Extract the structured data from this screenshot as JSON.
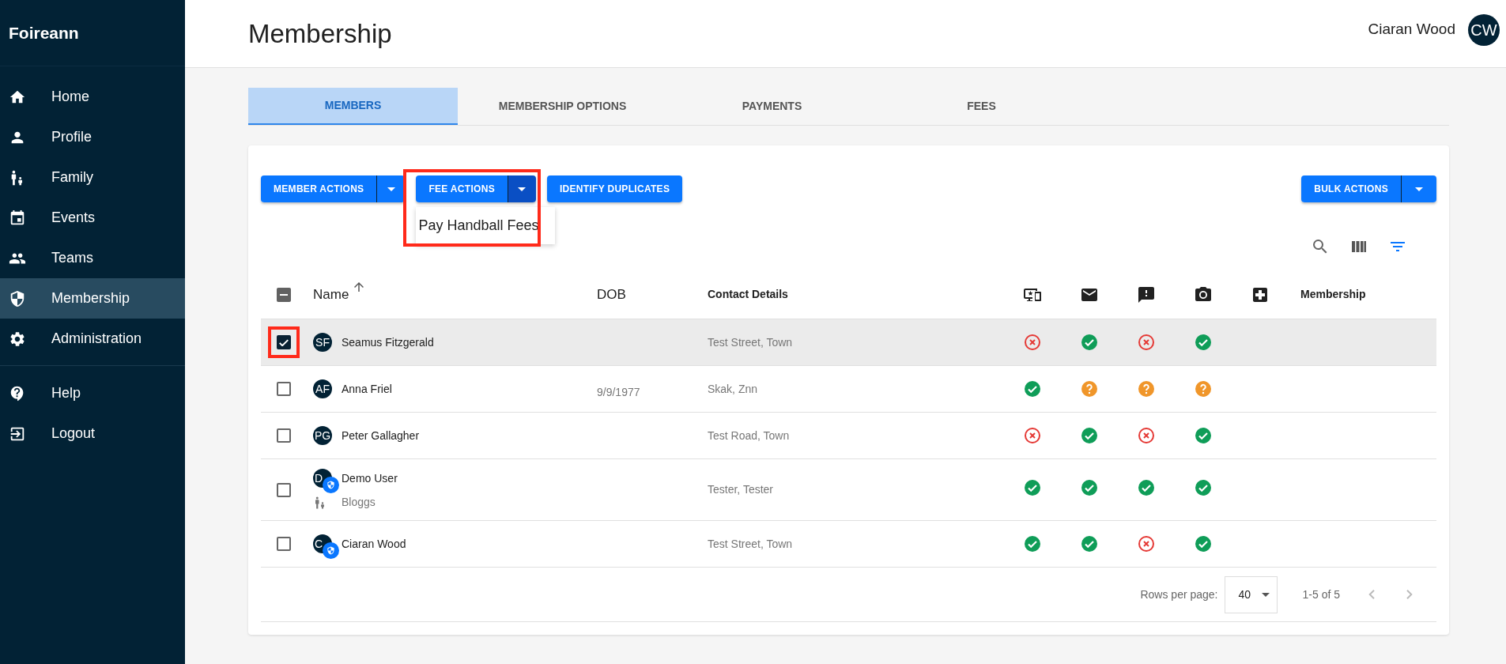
{
  "sidebar": {
    "brand": "Foireann",
    "items": [
      {
        "label": "Home",
        "selected": false
      },
      {
        "label": "Profile",
        "selected": false
      },
      {
        "label": "Family",
        "selected": false
      },
      {
        "label": "Events",
        "selected": false
      },
      {
        "label": "Teams",
        "selected": false
      },
      {
        "label": "Membership",
        "selected": true
      },
      {
        "label": "Administration",
        "selected": false
      }
    ],
    "footer_items": [
      {
        "label": "Help"
      },
      {
        "label": "Logout"
      }
    ]
  },
  "header": {
    "title": "Membership",
    "user_name": "Ciaran Wood",
    "user_initials": "CW"
  },
  "tabs": [
    {
      "label": "MEMBERS",
      "selected": true
    },
    {
      "label": "MEMBERSHIP OPTIONS",
      "selected": false
    },
    {
      "label": "PAYMENTS",
      "selected": false
    },
    {
      "label": "FEES",
      "selected": false
    }
  ],
  "toolbar": {
    "buttons": [
      {
        "kind": "split",
        "label": "MEMBER ACTIONS",
        "open": false
      },
      {
        "kind": "split",
        "label": "FEE ACTIONS",
        "open": true,
        "menu": [
          "Pay Handball Fees"
        ]
      },
      {
        "kind": "plain",
        "label": "IDENTIFY DUPLICATES",
        "open": false
      }
    ],
    "bulk": {
      "label": "BULK ACTIONS"
    }
  },
  "table": {
    "columns": [
      {
        "kind": "select",
        "indeterminate": true
      },
      {
        "kind": "text",
        "label": "Name",
        "sorted": true
      },
      {
        "kind": "text",
        "label": "DOB",
        "sorted": false
      },
      {
        "kind": "bold",
        "label": "Contact Details"
      },
      {
        "kind": "icon"
      },
      {
        "kind": "icon"
      },
      {
        "kind": "icon"
      },
      {
        "kind": "icon"
      },
      {
        "kind": "icon"
      },
      {
        "kind": "bold",
        "label": "Membership"
      }
    ],
    "rows": [
      {
        "checked": true,
        "initials": "SF",
        "name": "Seamus Fitzgerald",
        "admin": false,
        "dob": "",
        "contact": "Test Street, Town",
        "statuses": [
          {
            "kind": "no"
          },
          {
            "kind": "yes"
          },
          {
            "kind": "no"
          },
          {
            "kind": "yes"
          }
        ]
      },
      {
        "checked": false,
        "initials": "AF",
        "name": "Anna Friel",
        "admin": false,
        "dob": "9/9/1977",
        "contact": "Skak, Znn",
        "statuses": [
          {
            "kind": "yes"
          },
          {
            "kind": "unknown"
          },
          {
            "kind": "unknown"
          },
          {
            "kind": "unknown"
          }
        ]
      },
      {
        "checked": false,
        "initials": "PG",
        "name": "Peter Gallagher",
        "admin": false,
        "dob": "",
        "contact": "Test Road, Town",
        "statuses": [
          {
            "kind": "no"
          },
          {
            "kind": "yes"
          },
          {
            "kind": "no"
          },
          {
            "kind": "yes"
          }
        ]
      },
      {
        "checked": false,
        "initials": "D",
        "name": "Demo User",
        "admin": true,
        "family": "Bloggs",
        "dob": "",
        "contact": "Tester, Tester",
        "statuses": [
          {
            "kind": "yes"
          },
          {
            "kind": "yes"
          },
          {
            "kind": "yes"
          },
          {
            "kind": "yes"
          }
        ]
      },
      {
        "checked": false,
        "initials": "C",
        "name": "Ciaran Wood",
        "admin": true,
        "dob": "",
        "contact": "Test Street, Town",
        "statuses": [
          {
            "kind": "yes"
          },
          {
            "kind": "yes"
          },
          {
            "kind": "no"
          },
          {
            "kind": "yes"
          }
        ]
      }
    ]
  },
  "pagination": {
    "rows_label": "Rows per page:",
    "rows_value": "40",
    "range": "1-5 of 5"
  }
}
